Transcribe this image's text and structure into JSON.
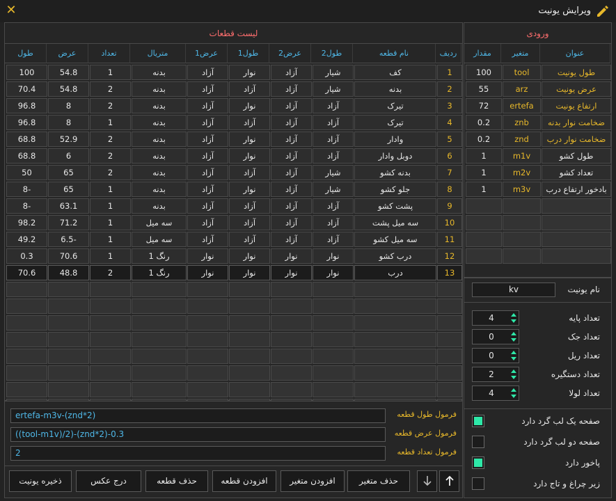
{
  "window": {
    "title": "ویرایش یونیت"
  },
  "parts_panel": {
    "title": "لیست قطعات",
    "columns": [
      "ردیف",
      "نام قطعه",
      "طول2",
      "عرض2",
      "طول1",
      "عرض1",
      "متریال",
      "تعداد",
      "عرض",
      "طول"
    ],
    "rows": [
      [
        "1",
        "کف",
        "شیار",
        "آزاد",
        "نوار",
        "آزاد",
        "بدنه",
        "1",
        "54.8",
        "100"
      ],
      [
        "2",
        "بدنه",
        "شیار",
        "آزاد",
        "آزاد",
        "آزاد",
        "بدنه",
        "2",
        "54.8",
        "70.4"
      ],
      [
        "3",
        "تیرک",
        "آزاد",
        "آزاد",
        "نوار",
        "آزاد",
        "بدنه",
        "2",
        "8",
        "96.8"
      ],
      [
        "4",
        "تیرک",
        "آزاد",
        "آزاد",
        "آزاد",
        "آزاد",
        "بدنه",
        "1",
        "8",
        "96.8"
      ],
      [
        "5",
        "وادار",
        "آزاد",
        "آزاد",
        "نوار",
        "آزاد",
        "بدنه",
        "2",
        "52.9",
        "68.8"
      ],
      [
        "6",
        "دوبل وادار",
        "آزاد",
        "آزاد",
        "نوار",
        "آزاد",
        "بدنه",
        "2",
        "6",
        "68.8"
      ],
      [
        "7",
        "بدنه کشو",
        "شیار",
        "آزاد",
        "آزاد",
        "آزاد",
        "بدنه",
        "2",
        "65",
        "50"
      ],
      [
        "8",
        "جلو کشو",
        "شیار",
        "آزاد",
        "نوار",
        "آزاد",
        "بدنه",
        "1",
        "65",
        "-8"
      ],
      [
        "9",
        "پشت کشو",
        "آزاد",
        "آزاد",
        "آزاد",
        "آزاد",
        "بدنه",
        "1",
        "63.1",
        "-8"
      ],
      [
        "10",
        "سه میل پشت",
        "آزاد",
        "آزاد",
        "آزاد",
        "آزاد",
        "سه میل",
        "1",
        "71.2",
        "98.2"
      ],
      [
        "11",
        "سه میل کشو",
        "آزاد",
        "آزاد",
        "آزاد",
        "آزاد",
        "سه میل",
        "1",
        "-6.5",
        "49.2"
      ],
      [
        "12",
        "درب کشو",
        "نوار",
        "نوار",
        "نوار",
        "نوار",
        "رنگ 1",
        "1",
        "70.6",
        "0.3"
      ],
      [
        "13",
        "درب",
        "نوار",
        "نوار",
        "نوار",
        "نوار",
        "رنگ 1",
        "2",
        "48.8",
        "70.6"
      ]
    ]
  },
  "formulas": {
    "length_label": "فرمول طول قطعه",
    "length_value": "ertefa-m3v-(znd*2)",
    "width_label": "فرمول عرض قطعه",
    "width_value": "((tool-m1v)/2)-(znd*2)-0.3",
    "count_label": "فرمول تعداد قطعه",
    "count_value": "2"
  },
  "buttons": {
    "save_unit": "ذخیره یونیت",
    "insert_image": "درج عکس",
    "delete_part": "حذف قطعه",
    "add_part": "افزودن قطعه",
    "add_variable": "افزودن متغیر",
    "delete_variable": "حذف متغیر"
  },
  "inputs_panel": {
    "title": "ورودی",
    "columns": [
      "عنوان",
      "متغیر",
      "مقدار"
    ],
    "rows": [
      [
        "طول یونیت",
        "tool",
        "100"
      ],
      [
        "عرض یونیت",
        "arz",
        "55"
      ],
      [
        "ارتفاع یونیت",
        "ertefa",
        "72"
      ],
      [
        "ضخامت نوار بدنه",
        "znb",
        "0.2"
      ],
      [
        "ضخامت نوار درب",
        "znd",
        "0.2"
      ],
      [
        "طول کشو",
        "m1v",
        "1"
      ],
      [
        "تعداد کشو",
        "m2v",
        "1"
      ],
      [
        "بادخور ارتفاع درب",
        "m3v",
        "1"
      ]
    ]
  },
  "unit_name": {
    "label": "نام یونیت",
    "value": "kv"
  },
  "counts": [
    {
      "label": "تعداد پایه",
      "value": "4"
    },
    {
      "label": "تعداد جک",
      "value": "0"
    },
    {
      "label": "تعداد ریل",
      "value": "0"
    },
    {
      "label": "تعداد دستگیره",
      "value": "2"
    },
    {
      "label": "تعداد لولا",
      "value": "4"
    }
  ],
  "options": [
    {
      "label": "صفحه یک لب گرد دارد",
      "checked": true
    },
    {
      "label": "صفحه دو لب گرد دارد",
      "checked": false
    },
    {
      "label": "پاخور دارد",
      "checked": true
    },
    {
      "label": "زیر چراغ و تاج دارد",
      "checked": false
    }
  ],
  "colors": {
    "accent": "#e8b82a",
    "header_text": "#4fb8e8",
    "panel_title": "#ff6e6e",
    "checkbox_on": "#2ee8a8"
  }
}
